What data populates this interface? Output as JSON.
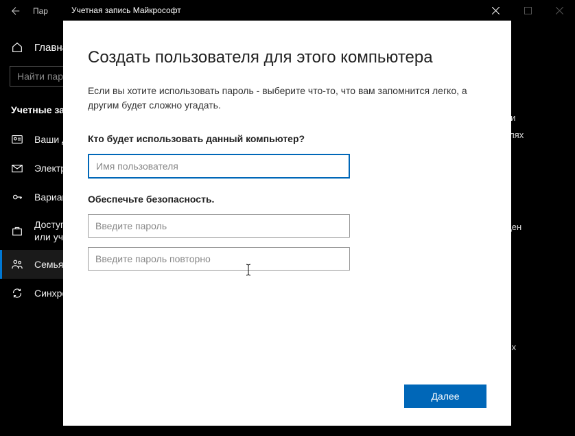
{
  "settings": {
    "title": "Пар",
    "home": "Главна",
    "search_placeholder": "Найти пар",
    "section": "Учетные за",
    "nav": [
      {
        "label": "Ваши д"
      },
      {
        "label": "Электр"
      },
      {
        "label": "Вариан"
      },
      {
        "label": "Доступ\nили уч"
      },
      {
        "label": "Семья"
      },
      {
        "label": "Синхро"
      }
    ],
    "bg_fragments": [
      "ами",
      "целях",
      "ещен",
      "ь их"
    ]
  },
  "modal": {
    "titlebar": "Учетная запись Майкрософт",
    "heading": "Создать пользователя для этого компьютера",
    "description": "Если вы хотите использовать пароль - выберите что-то, что вам запомнится легко, а другим будет сложно угадать.",
    "q1_label": "Кто будет использовать данный компьютер?",
    "username_placeholder": "Имя пользователя",
    "q2_label": "Обеспечьте безопасность.",
    "password_placeholder": "Введите пароль",
    "password2_placeholder": "Введите пароль повторно",
    "next_button": "Далее"
  }
}
